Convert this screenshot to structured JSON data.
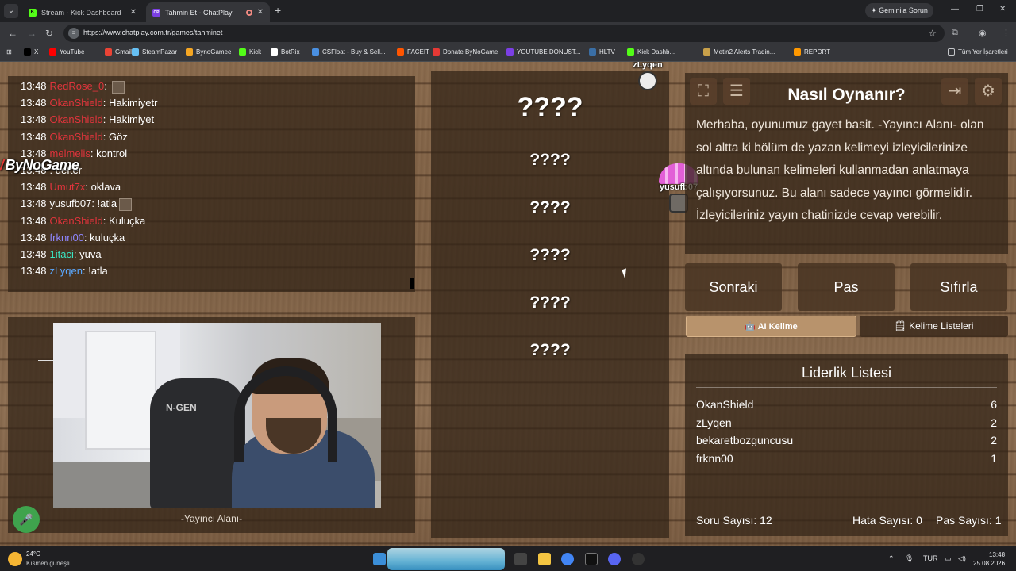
{
  "browser": {
    "tabs": [
      {
        "title": "Stream - Kick Dashboard",
        "favicon": "K"
      },
      {
        "title": "Tahmin Et - ChatPlay",
        "favicon": "CP"
      }
    ],
    "gemini_label": "Gemini'a Sorun",
    "url": "https://www.chatplay.com.tr/games/tahminet",
    "bookmarks": [
      {
        "label": "X",
        "color": "#000000"
      },
      {
        "label": "YouTube",
        "color": "#ff0000"
      },
      {
        "label": "Gmail",
        "color": "#ea4335"
      },
      {
        "label": "SteamPazar",
        "color": "#66c0f4"
      },
      {
        "label": "BynoGamee",
        "color": "#f5a623"
      },
      {
        "label": "Kick",
        "color": "#53fc18"
      },
      {
        "label": "BotRix",
        "color": "#ffffff"
      },
      {
        "label": "CSFloat - Buy & Sell...",
        "color": "#4a90e2"
      },
      {
        "label": "FACEIT",
        "color": "#ff5500"
      },
      {
        "label": "Donate ByNoGame",
        "color": "#e53935"
      },
      {
        "label": "YOUTUBE DONUST...",
        "color": "#7b3fe4"
      },
      {
        "label": "HLTV",
        "color": "#3a6ea5"
      },
      {
        "label": "Kick Dashb...",
        "color": "#53fc18"
      },
      {
        "label": "Metin2 Alerts Tradin...",
        "color": "#c8a04a"
      },
      {
        "label": "REPORT",
        "color": "#ff9800"
      }
    ],
    "all_bookmarks_label": "Tüm Yer İşaretleri"
  },
  "overlay": {
    "brand": "ByNoGame"
  },
  "chat": [
    {
      "time": "13:48",
      "user": "RedRose_0",
      "color": "#e0343c",
      "message": "",
      "emote": true
    },
    {
      "time": "13:48",
      "user": "OkanShield",
      "color": "#e0343c",
      "message": "Hakimiyetr"
    },
    {
      "time": "13:48",
      "user": "OkanShield",
      "color": "#e0343c",
      "message": "Hakimiyet"
    },
    {
      "time": "13:48",
      "user": "OkanShield",
      "color": "#e0343c",
      "message": "Göz"
    },
    {
      "time": "13:48",
      "user": "melmelis",
      "color": "#e0343c",
      "message": "kontrol"
    },
    {
      "time": "13:48",
      "user": "",
      "color": "#e0343c",
      "message": "defter"
    },
    {
      "time": "13:48",
      "user": "Umut7x",
      "color": "#e0343c",
      "message": "oklava"
    },
    {
      "time": "13:48",
      "user": "yusufb07",
      "color": "#ffffff",
      "message": "!atla",
      "emote": true
    },
    {
      "time": "13:48",
      "user": "OkanShield",
      "color": "#e0343c",
      "message": "Kuluçka"
    },
    {
      "time": "13:48",
      "user": "frknn00",
      "color": "#8f86ff",
      "message": "kuluçka"
    },
    {
      "time": "13:48",
      "user": "1itaci",
      "color": "#3ae6c4",
      "message": "yuva"
    },
    {
      "time": "13:48",
      "user": "zLyqen",
      "color": "#5aa8ff",
      "message": "!atla"
    }
  ],
  "streamer": {
    "label": "-Yayıncı Alanı-",
    "chair_brand": "N-GEN"
  },
  "words": {
    "first": "????",
    "rest": [
      "????",
      "????",
      "????",
      "????",
      "????"
    ]
  },
  "parachutes": [
    {
      "name": "zLyqen"
    },
    {
      "name": "yusufb07"
    }
  ],
  "info": {
    "title": "Nasıl Oynanır?",
    "text": "Merhaba, oyunumuz gayet basit. -Yayıncı Alanı- olan sol altta ki bölüm de yazan kelimeyi izleyicilerinize altında bulunan kelimeleri kullanmadan anlatmaya çalışıyorsunuz. Bu alanı sadece yayıncı görmelidir. İzleyicileriniz yayın chatinizde cevap verebilir."
  },
  "actions": {
    "next": "Sonraki",
    "pass": "Pas",
    "reset": "Sıfırla",
    "ai_word": "AI Kelime",
    "word_lists": "Kelime Listeleri"
  },
  "leaderboard": {
    "title": "Liderlik Listesi",
    "rows": [
      {
        "name": "OkanShield",
        "score": "6"
      },
      {
        "name": "zLyqen",
        "score": "2"
      },
      {
        "name": "bekaretbozguncusu",
        "score": "2"
      },
      {
        "name": "frknn00",
        "score": "1"
      }
    ],
    "question_count": "Soru Sayısı: 12",
    "error_count": "Hata Sayısı: 0",
    "pass_count": "Pas Sayısı: 1"
  },
  "taskbar": {
    "temperature": "24°C",
    "weather": "Kısmen güneşli",
    "lang": "TUR",
    "time": "13:48",
    "date": "25.08.2026"
  }
}
